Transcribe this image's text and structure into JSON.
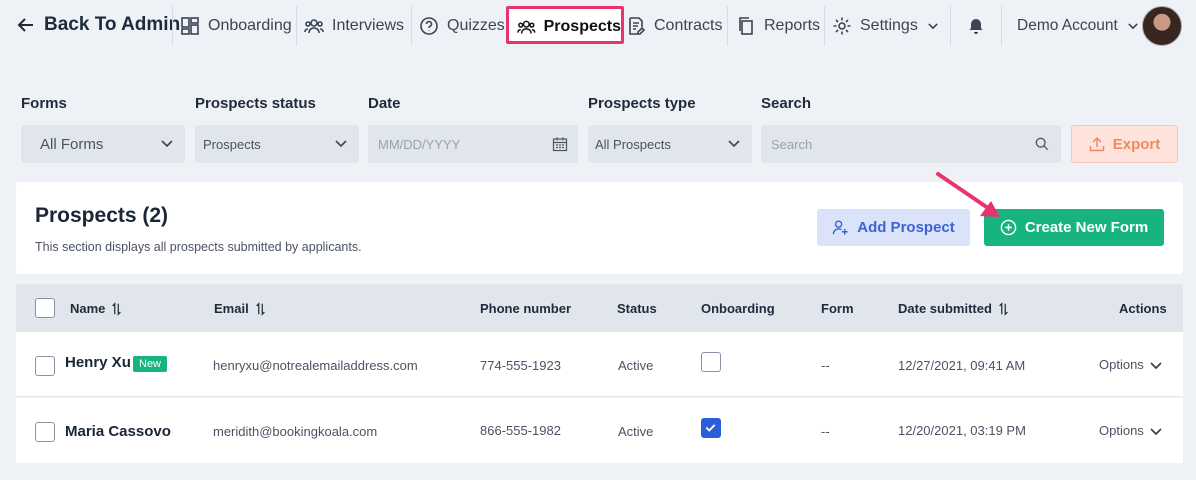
{
  "nav": {
    "back_label": "Back To Admin",
    "items": [
      {
        "label": "Onboarding"
      },
      {
        "label": "Interviews"
      },
      {
        "label": "Quizzes"
      },
      {
        "label": "Prospects"
      },
      {
        "label": "Contracts"
      },
      {
        "label": "Reports"
      },
      {
        "label": "Settings"
      }
    ],
    "account_label": "Demo Account"
  },
  "filters": {
    "forms": {
      "label": "Forms",
      "value": "All Forms"
    },
    "status": {
      "label": "Prospects status",
      "value": "Prospects"
    },
    "date": {
      "label": "Date",
      "placeholder": "MM/DD/YYYY"
    },
    "type": {
      "label": "Prospects type",
      "value": "All Prospects"
    },
    "search": {
      "label": "Search",
      "placeholder": "Search"
    },
    "export_label": "Export"
  },
  "section": {
    "title": "Prospects (2)",
    "subtitle": "This section displays all prospects submitted by applicants.",
    "add_label": "Add Prospect",
    "create_label": "Create New Form"
  },
  "table": {
    "columns": [
      "Name",
      "Email",
      "Phone number",
      "Status",
      "Onboarding",
      "Form",
      "Date submitted",
      "Actions"
    ],
    "rows": [
      {
        "name": "Henry Xu",
        "badge": "New",
        "email": "henryxu@notrealemailaddress.com",
        "phone": "774-555-1923",
        "status": "Active",
        "onboarding": false,
        "form": "--",
        "date": "12/27/2021, 09:41 AM",
        "action": "Options"
      },
      {
        "name": "Maria Cassovo",
        "badge": "",
        "email": "meridith@bookingkoala.com",
        "phone": "866-555-1982",
        "status": "Active",
        "onboarding": true,
        "form": "--",
        "date": "12/20/2021, 03:19 PM",
        "action": "Options"
      }
    ]
  },
  "colors": {
    "accent_green": "#17b57d",
    "highlight_pink": "#e8336f",
    "primary_blue": "#2b5fd9"
  }
}
